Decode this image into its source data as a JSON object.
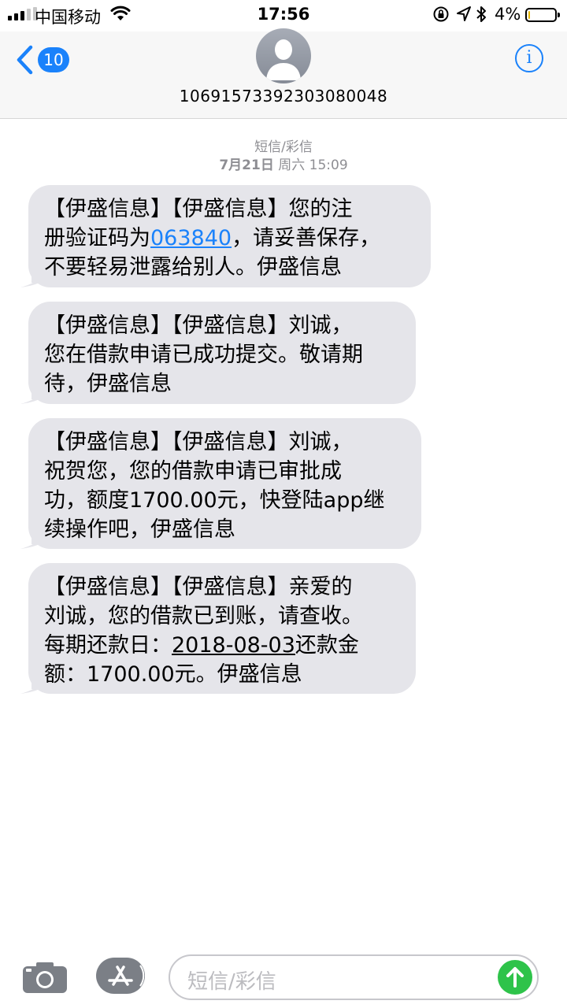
{
  "status_bar": {
    "carrier": "中国移动",
    "time": "17:56",
    "battery_percent": "4%",
    "battery_level": 0.04,
    "icons": [
      "signal-icon",
      "wifi-icon",
      "orientation-lock-icon",
      "location-icon",
      "bluetooth-icon",
      "battery-icon"
    ]
  },
  "header": {
    "back_badge": "10",
    "contact_number": "10691573392303080048",
    "info_icon": "i"
  },
  "conversation": {
    "service_label": "短信/彩信",
    "date": "7月21日",
    "weekday_time": "周六 15:09"
  },
  "messages": [
    {
      "line1": "【伊盛信息】【伊盛信息】您的注",
      "line2_pre": "册验证码为",
      "code": "063840",
      "line2_post": "，请妥善保存，",
      "line3": "不要轻易泄露给别人。伊盛信息"
    },
    {
      "line1": "【伊盛信息】【伊盛信息】刘诚，",
      "line2": "您在借款申请已成功提交。敬请期",
      "line3": "待，伊盛信息"
    },
    {
      "line1": "【伊盛信息】【伊盛信息】刘诚，",
      "line2": "祝贺您，您的借款申请已审批成",
      "line3": "功，额度1700.00元，快登陆app继",
      "line4": "续操作吧，伊盛信息"
    },
    {
      "line1": "【伊盛信息】【伊盛信息】亲爱的",
      "line2": "刘诚，您的借款已到账，请查收。",
      "line3_pre": "每期还款日：",
      "date": "2018-08-03",
      "line3_post": "还款金",
      "line4": "额：1700.00元。伊盛信息"
    }
  ],
  "input_bar": {
    "placeholder": "短信/彩信",
    "icons": [
      "camera-icon",
      "app-store-icon",
      "send-arrow-icon"
    ]
  },
  "colors": {
    "accent": "#1a82fb",
    "bubble": "#e5e5ea",
    "send": "#2ec34a",
    "meta_text": "#8e8e93"
  }
}
